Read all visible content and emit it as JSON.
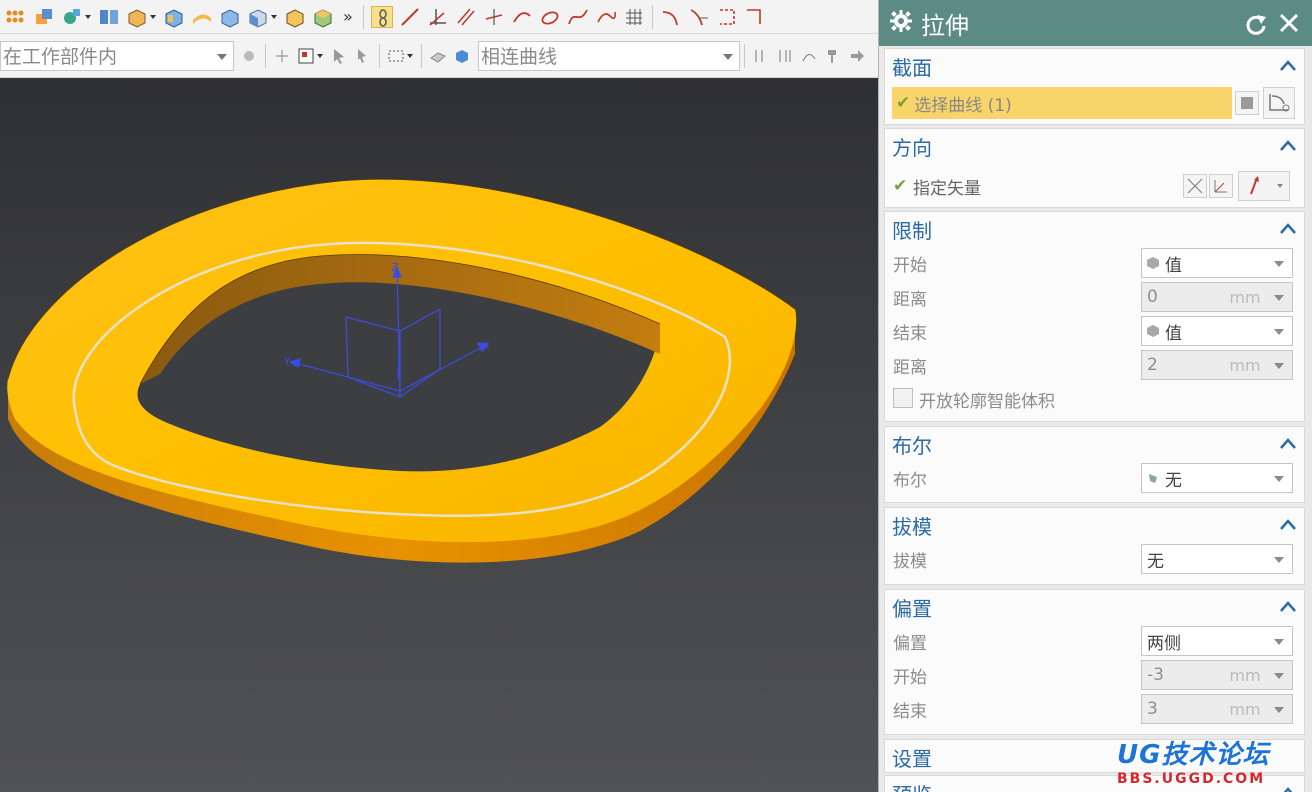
{
  "toolbar": {
    "scope_combo": "在工作部件内",
    "curve_rule_combo": "相连曲线",
    "overflow_glyph": "»"
  },
  "viewport": {
    "axis_labels": {
      "z": "Z",
      "y": "Y",
      "x": "X"
    },
    "part_color": "#ffc000",
    "edge_color": "#e08600"
  },
  "dialog": {
    "title": "拉伸",
    "title_bar_color": "#5c8a85",
    "sections": {
      "section": {
        "header": "截面",
        "select_curve": "选择曲线 (1)"
      },
      "direction": {
        "header": "方向",
        "specify_vector": "指定矢量"
      },
      "limits": {
        "header": "限制",
        "start_label": "开始",
        "start_value": "值",
        "start_distance_label": "距离",
        "start_distance": "0",
        "end_label": "结束",
        "end_value": "值",
        "end_distance_label": "距离",
        "end_distance": "2",
        "unit": "mm",
        "open_profile": "开放轮廓智能体积"
      },
      "boolean": {
        "header": "布尔",
        "label": "布尔",
        "value": "无"
      },
      "draft": {
        "header": "拔模",
        "label": "拔模",
        "value": "无"
      },
      "offset": {
        "header": "偏置",
        "label": "偏置",
        "value": "两侧",
        "start_label": "开始",
        "start_value": "-3",
        "end_label": "结束",
        "end_value": "3",
        "unit": "mm"
      },
      "settings": {
        "header": "设置"
      },
      "preview": {
        "header": "预览"
      }
    }
  },
  "watermark": {
    "logo_text": "UG技术论坛",
    "url": "BBS.UGGD.COM"
  }
}
